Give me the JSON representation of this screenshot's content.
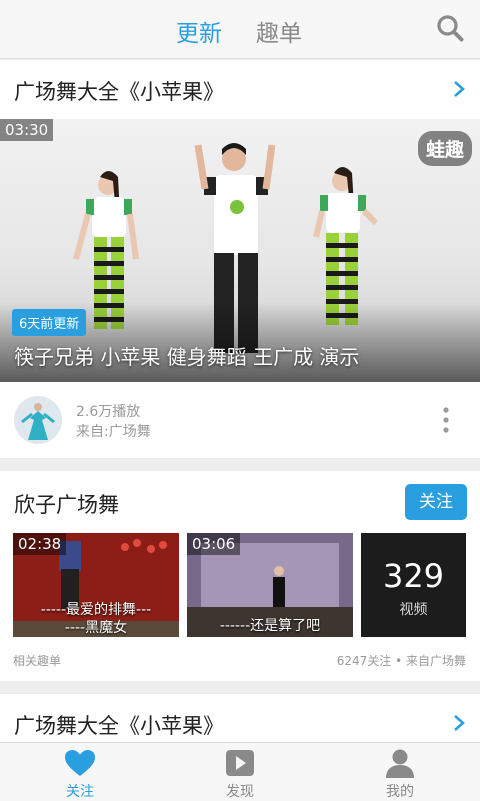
{
  "header": {
    "tabs": [
      {
        "label": "更新",
        "active": true
      },
      {
        "label": "趣单",
        "active": false
      }
    ],
    "search_icon": "search-icon"
  },
  "section1": {
    "title": "广场舞大全《小苹果》",
    "video": {
      "duration": "03:30",
      "brand": "蛙趣",
      "badge": "6天前更新",
      "title": "筷子兄弟 小苹果 健身舞蹈 王广成 演示",
      "plays": "2.6万播放",
      "source": "来自:广场舞"
    }
  },
  "section2": {
    "title": "欣子广场舞",
    "follow_label": "关注",
    "thumbs": [
      {
        "duration": "02:38",
        "caption_line1": "-----最爱的排舞---",
        "caption_line2": "----黑魔女"
      },
      {
        "duration": "03:06",
        "caption_line1": "------还是算了吧"
      }
    ],
    "count": {
      "value": "329",
      "label": "视频"
    },
    "footer_left": "相关趣单",
    "footer_right": "6247关注 • 来自广场舞"
  },
  "section3": {
    "title": "广场舞大全《小苹果》"
  },
  "bottom_nav": [
    {
      "label": "关注",
      "icon": "heart-icon",
      "active": true
    },
    {
      "label": "发现",
      "icon": "play-icon",
      "active": false
    },
    {
      "label": "我的",
      "icon": "user-icon",
      "active": false
    }
  ],
  "colors": {
    "accent": "#2a9fe0",
    "inactive": "#8a8a8a"
  }
}
